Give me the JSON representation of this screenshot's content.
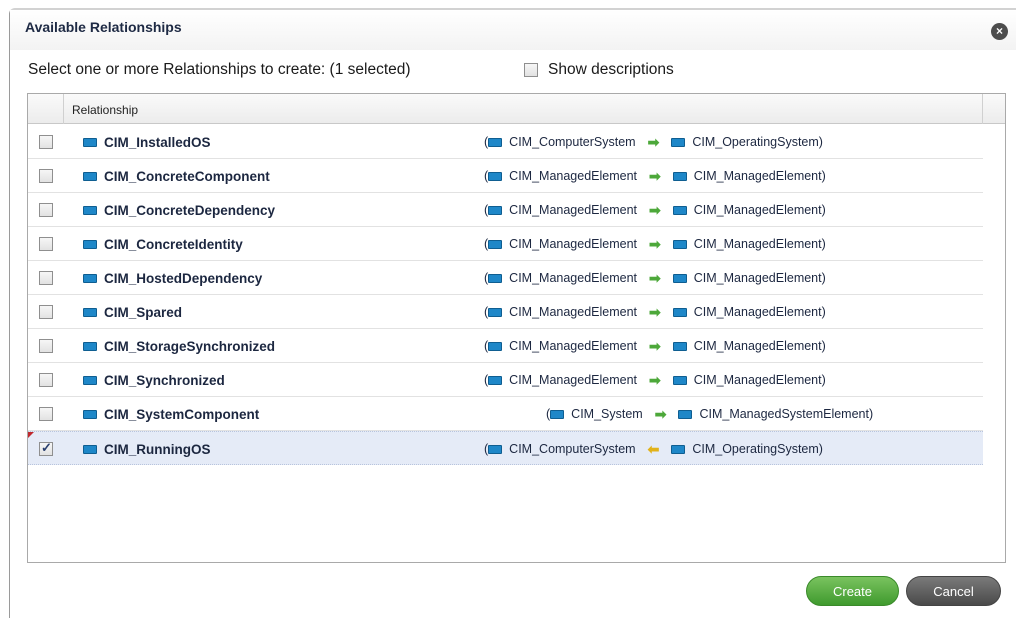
{
  "dialog": {
    "title": "Available Relationships",
    "close_icon": "close-icon",
    "instructions": "Select one or more Relationships to create:  (1 selected)",
    "show_descriptions_label": "Show descriptions",
    "show_descriptions_checked": false
  },
  "table": {
    "column_header": "Relationship",
    "rows": [
      {
        "name": "CIM_InstalledOS",
        "checked": false,
        "source": "CIM_ComputerSystem",
        "direction": "right",
        "target": "CIM_OperatingSystem"
      },
      {
        "name": "CIM_ConcreteComponent",
        "checked": false,
        "source": "CIM_ManagedElement",
        "direction": "right",
        "target": "CIM_ManagedElement"
      },
      {
        "name": "CIM_ConcreteDependency",
        "checked": false,
        "source": "CIM_ManagedElement",
        "direction": "right",
        "target": "CIM_ManagedElement"
      },
      {
        "name": "CIM_ConcreteIdentity",
        "checked": false,
        "source": "CIM_ManagedElement",
        "direction": "right",
        "target": "CIM_ManagedElement"
      },
      {
        "name": "CIM_HostedDependency",
        "checked": false,
        "source": "CIM_ManagedElement",
        "direction": "right",
        "target": "CIM_ManagedElement"
      },
      {
        "name": "CIM_Spared",
        "checked": false,
        "source": "CIM_ManagedElement",
        "direction": "right",
        "target": "CIM_ManagedElement"
      },
      {
        "name": "CIM_StorageSynchronized",
        "checked": false,
        "source": "CIM_ManagedElement",
        "direction": "right",
        "target": "CIM_ManagedElement"
      },
      {
        "name": "CIM_Synchronized",
        "checked": false,
        "source": "CIM_ManagedElement",
        "direction": "right",
        "target": "CIM_ManagedElement"
      },
      {
        "name": "CIM_SystemComponent",
        "checked": false,
        "source": "CIM_System",
        "direction": "right",
        "target": "CIM_ManagedSystemElement"
      },
      {
        "name": "CIM_RunningOS",
        "checked": true,
        "source": "CIM_ComputerSystem",
        "direction": "left",
        "target": "CIM_OperatingSystem"
      }
    ]
  },
  "buttons": {
    "create_label": "Create",
    "cancel_label": "Cancel"
  },
  "colors": {
    "create_button": "#4fa83a",
    "cancel_button": "#5a5a5a",
    "class_icon": "#1e87c8",
    "selected_row": "#e5ebf7",
    "arrow_right": "#4da83a",
    "arrow_left": "#e1b21a"
  }
}
